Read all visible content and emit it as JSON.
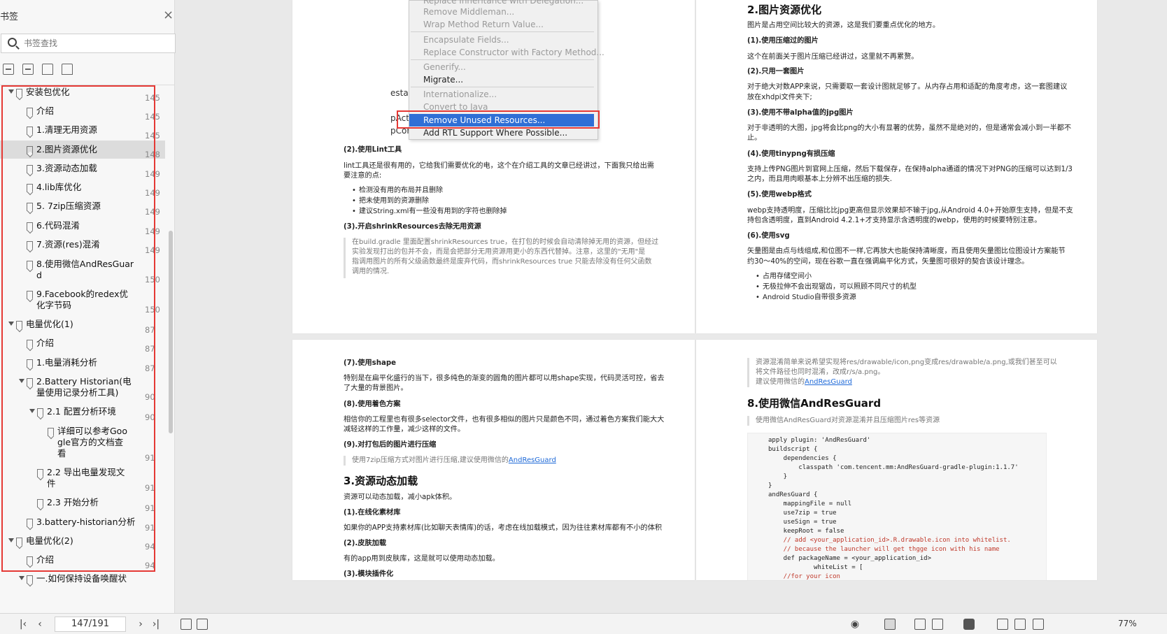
{
  "sidebar": {
    "title": "书签",
    "search_placeholder": "书签查找",
    "items": [
      {
        "label": "安装包优化",
        "page": "145"
      },
      {
        "label": "介绍",
        "page": "145"
      },
      {
        "label": "1.清理无用资源",
        "page": "145"
      },
      {
        "label": "2.图片资源优化",
        "page": "148"
      },
      {
        "label": "3.资源动态加载",
        "page": "149"
      },
      {
        "label": "4.lib库优化",
        "page": "149"
      },
      {
        "label": "5. 7zip压缩资源",
        "page": "149"
      },
      {
        "label": "6.代码混淆",
        "page": "149"
      },
      {
        "label": "7.资源(res)混淆",
        "page": "149"
      },
      {
        "label": "8.使用微信AndResGuar",
        "label2": "d",
        "page": "150"
      },
      {
        "label": "9.Facebook的redex优",
        "label2": "化字节码",
        "page": "150"
      },
      {
        "label": "电量优化(1)",
        "page": "87"
      },
      {
        "label": "介绍",
        "page": "87"
      },
      {
        "label": "1.电量消耗分析",
        "page": "87"
      },
      {
        "label": "2.Battery Historian(电",
        "label2": "量使用记录分析工具)",
        "page": "90"
      },
      {
        "label": "2.1 配置分析环境",
        "page": "90"
      },
      {
        "label": "详细可以参考Goo",
        "label2": "gle官方的文档查",
        "label3": "看",
        "page": "91"
      },
      {
        "label": "2.2 导出电量发现文",
        "label2": "件",
        "page": "91"
      },
      {
        "label": "2.3 开始分析",
        "page": "91"
      },
      {
        "label": "3.battery-historian分析",
        "page": "91"
      },
      {
        "label": "电量优化(2)",
        "page": "94"
      },
      {
        "label": "介绍",
        "page": "94"
      },
      {
        "label": "一.如何保持设备唤醒状",
        "page": ""
      }
    ]
  },
  "menu": {
    "items": [
      "Replace Inheritance with Delegation...",
      "Remove Middleman...",
      "Wrap Method Return Value...",
      "Encapsulate Fields...",
      "Replace Constructor with Factory Method...",
      "Generify...",
      "Migrate...",
      "Internationalize...",
      "Convert to Java",
      "Remove Unused Resources...",
      "Add RTL Support Where Possible..."
    ],
    "behind": [
      "estac",
      "pAct",
      "pCor"
    ]
  },
  "page1": {
    "lint_title": "(2).使用Lint工具",
    "lint_p1": "lint工具还是很有用的，它给我们需要优化的电，这个在介绍工具的文章已经讲过，下面我只给出需",
    "lint_p2": "要注意的点:",
    "bullets": [
      "检测没有用的布局并且删除",
      "把未使用到的资源删除",
      "建议String.xml有一些没有用到的字符也删除掉"
    ],
    "shrink_title": "(3).开启shrinkResources去除无用资源",
    "quote": [
      "在build.gradle 里面配置shrinkResources true，在打包的时候会自动清除掉无用的资源，但经过",
      "实验发现打出的包并不会，而是会把部分无用资源用更小的东西代替掉。注意，这里的\"无用\"是",
      "指调用图片的所有父级函数最终是废弃代码，而shrinkResources true 只能去除没有任何父函数",
      "调用的情况."
    ]
  },
  "page2": {
    "heading": "2.图片资源优化",
    "intro": "图片是占用空间比较大的资源，这是我们要重点优化的地方。",
    "s1_title": "(1).使用压缩过的图片",
    "s1": "这个在前面关于图片压缩已经讲过，这里就不再累赘。",
    "s2_title": "(2).只用一套图片",
    "s2a": "对于绝大对数APP来说，只需要取一套设计图就足够了。从内存占用和适配的角度考虑，这一套图建议",
    "s2b": "放在xhdpi文件夹下;",
    "s3_title": "(3).使用不带alpha值的jpg图片",
    "s3a": "对于非透明的大图，jpg将会比png的大小有显著的优势，虽然不是绝对的，但是通常会减小到一半都不",
    "s3b": "止。",
    "s4_title": "(4).使用tinypng有损压缩",
    "s4a": "支持上传PNG图片到官网上压缩，然后下载保存，在保持alpha通道的情况下对PNG的压缩可以达到1/3",
    "s4b": "之内，而且用肉眼基本上分辨不出压缩的损失.",
    "s5_title": "(5).使用webp格式",
    "s5a": "webp支持透明度，压缩比比jpg更高但显示效果却不输于jpg,从Android 4.0+开始原生支持，但是不支",
    "s5b": "持包含透明度，直到Android 4.2.1+才支持显示含透明度的webp，使用的时候要特别注意。",
    "s6_title": "(6).使用svg",
    "s6a": "矢量图是由点与线组成,和位图不一样,它再放大也能保持清晰度，而且使用矢量图比位图设计方案能节",
    "s6b": "约30～40%的空间，现在谷歌一直在强调扁平化方式，矢量图可很好的契合该设计理念。",
    "bullets": [
      "占用存储空间小",
      "无极拉伸不会出现锯齿，可以照顾不同尺寸的机型",
      "Android Studio自带很多资源"
    ]
  },
  "page3": {
    "s7_title": "(7).使用shape",
    "s7a": "特别是在扁平化盛行的当下，很多纯色的渐变的圆角的图片都可以用shape实现，代码灵活可控，省去",
    "s7b": "了大量的背景图片。",
    "s8_title": "(8).使用着色方案",
    "s8a": "相信你的工程里也有很多selector文件，也有很多相似的图片只是颜色不同，通过着色方案我们能大大",
    "s8b": "减轻这样的工作量，减少这样的文件。",
    "s9_title": "(9).对打包后的图片进行压缩",
    "s9_quote": "使用7zip压缩方式对图片进行压缩,建议使用微信的",
    "s9_link": "AndResGuard",
    "heading": "3.资源动态加载",
    "intro": "资源可以动态加载，减小apk体积。",
    "o1_title": "(1).在线化素材库",
    "o1": "如果你的APP支持素材库(比如聊天表情库)的话，考虑在线加载模式，因为往往素材库都有不小的体积",
    "o2_title": "(2).皮肤加载",
    "o2": "有的app用到皮肤库，这是就可以使用动态加载。",
    "o3_title": "(3).模块插件化"
  },
  "page4": {
    "quote1": "资源混淆简单来说希望实现将res/drawable/icon,png变成res/drawable/a.png,或我们甚至可以",
    "quote2": "将文件路径也同时混淆，改成r/s/a.png。",
    "quote3": "建议使用微信的",
    "quote_link": "AndResGuard",
    "heading": "8.使用微信AndResGuard",
    "quote4": "使用微信AndResGuard对资源混淆并且压缩图片res等资源",
    "code": [
      "apply plugin: 'AndResGuard'",
      "buildscript {",
      "    dependencies {",
      "        classpath 'com.tencent.mm:AndResGuard-gradle-plugin:1.1.7'",
      "    }",
      "}",
      "andResGuard {",
      "    mappingFile = null",
      "    use7zip = true",
      "    useSign = true",
      "    keepRoot = false",
      "    // add <your_application_id>.R.drawable.icon into whitelist.",
      "    // because the launcher will get thgge icon with his name",
      "    def packageName = <your_application_id>",
      "            whiteList = [",
      "    //for your icon"
    ]
  },
  "toolbar": {
    "page_indicator": "147/191",
    "zoom": "77%"
  }
}
